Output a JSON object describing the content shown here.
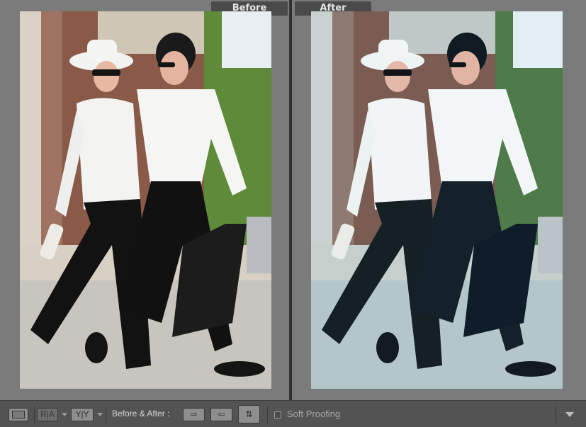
{
  "panes": {
    "before_label": "Before",
    "after_label": "After"
  },
  "toolbar": {
    "view_loupe_icon": "single-view-icon",
    "ra_label": "R|A",
    "yy_label": "Y|Y",
    "before_after_label": "Before & After :",
    "copy_before_to_after_icon": "copy-right-icon",
    "copy_after_to_before_icon": "copy-left-icon",
    "swap_icon": "swap-icon",
    "soft_proofing_label": "Soft Proofing",
    "soft_proofing_checked": false,
    "menu_icon": "dropdown-triangle-icon"
  },
  "colors": {
    "before_tone": "#c9c4bc",
    "after_tone": "#a9c3c8"
  }
}
